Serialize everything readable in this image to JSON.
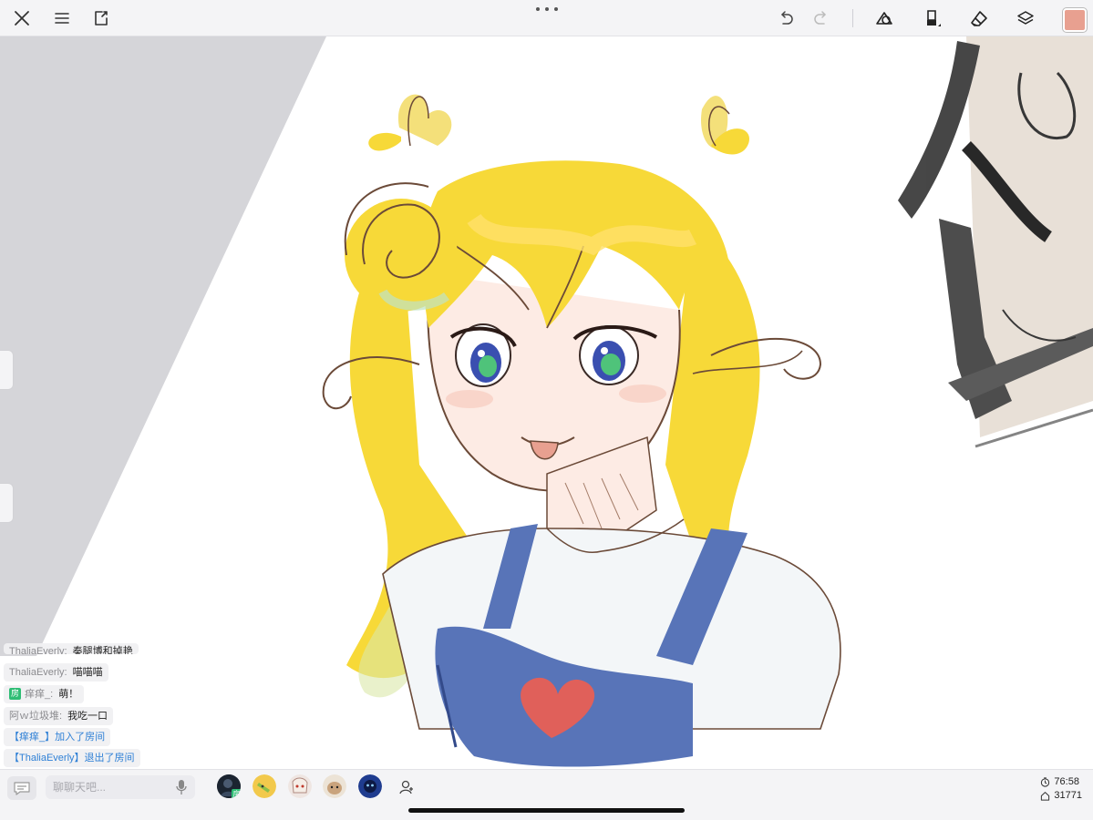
{
  "toolbar": {
    "left_icons": [
      "close-icon",
      "menu-icon",
      "export-icon"
    ],
    "right_icons": [
      "undo-icon",
      "redo-icon",
      "shapes-icon",
      "brush-icon",
      "eraser-icon",
      "layers-icon"
    ],
    "current_color": "#e8a090"
  },
  "chat": {
    "messages": [
      {
        "type": "user",
        "name": "ThaliaEverly:",
        "text": "秦腿博和掉艳"
      },
      {
        "type": "user",
        "name": "ThaliaEverly:",
        "text": "喵喵喵"
      },
      {
        "type": "room",
        "badge": "房",
        "name": "痒痒_:",
        "text": "萌！"
      },
      {
        "type": "user",
        "name": "阿ｗ垃圾堆:",
        "text": "我吃一口"
      },
      {
        "type": "system",
        "text": "【痒痒_】加入了房间"
      },
      {
        "type": "system",
        "text": "【ThaliaEverly】退出了房间"
      }
    ],
    "input_placeholder": "聊聊天吧..."
  },
  "participants": [
    {
      "name": "participant-1",
      "badge": "房",
      "color": "#1b2430"
    },
    {
      "name": "participant-2",
      "badge": "",
      "color": "#f2c94c"
    },
    {
      "name": "participant-3",
      "badge": "",
      "color": "#e9d9d4"
    },
    {
      "name": "participant-4",
      "badge": "",
      "color": "#c9a37d"
    },
    {
      "name": "participant-5",
      "badge": "",
      "color": "#1f3c8f"
    }
  ],
  "stats": {
    "timer": "76:58",
    "popularity": "31771"
  },
  "colors": {
    "toolbar_bg": "#f4f4f6",
    "hair": "#f7d938",
    "overalls": "#5874b8",
    "heart": "#e0605a",
    "system_text": "#2f80d6",
    "badge_green": "#2ebd74"
  }
}
